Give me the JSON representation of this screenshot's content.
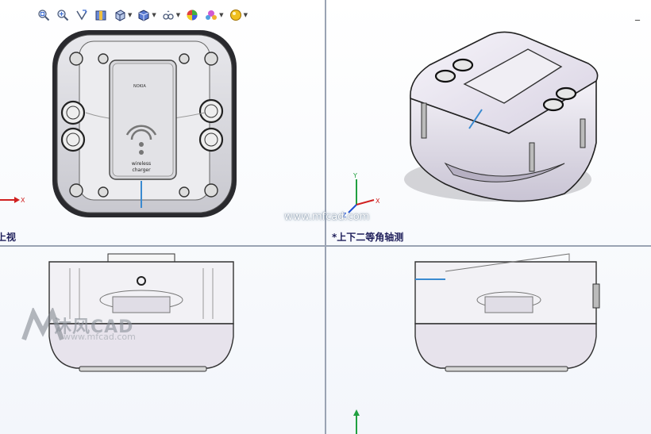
{
  "viewports": {
    "top_left": {
      "label": "上视"
    },
    "top_right": {
      "label": "*上下二等角轴测"
    },
    "bottom_left": {
      "label": ""
    },
    "bottom_right": {
      "label": ""
    }
  },
  "toolbar": {
    "buttons": [
      {
        "name": "zoom-to-fit-icon",
        "has_menu": false
      },
      {
        "name": "zoom-to-area-icon",
        "has_menu": false
      },
      {
        "name": "previous-view-icon",
        "has_menu": false
      },
      {
        "name": "section-view-icon",
        "has_menu": false
      },
      {
        "name": "view-orientation-icon",
        "has_menu": true
      },
      {
        "name": "display-style-icon",
        "has_menu": true
      },
      {
        "name": "hide-show-items-icon",
        "has_menu": true
      },
      {
        "name": "edit-appearance-icon",
        "has_menu": false
      },
      {
        "name": "apply-scene-icon",
        "has_menu": true
      },
      {
        "name": "view-settings-icon",
        "has_menu": true
      }
    ]
  },
  "window": {
    "minimize_label": "_"
  },
  "axes": {
    "x": "X",
    "y": "Y",
    "z": "Z"
  },
  "device": {
    "card_brand": "NOKIA",
    "card_text_line1": "wireless",
    "card_text_line2": "charger"
  },
  "watermark": {
    "url": "www.mfcad.com",
    "logo_text": "沐风CAD",
    "logo_sub": "www.mfcad.com"
  }
}
